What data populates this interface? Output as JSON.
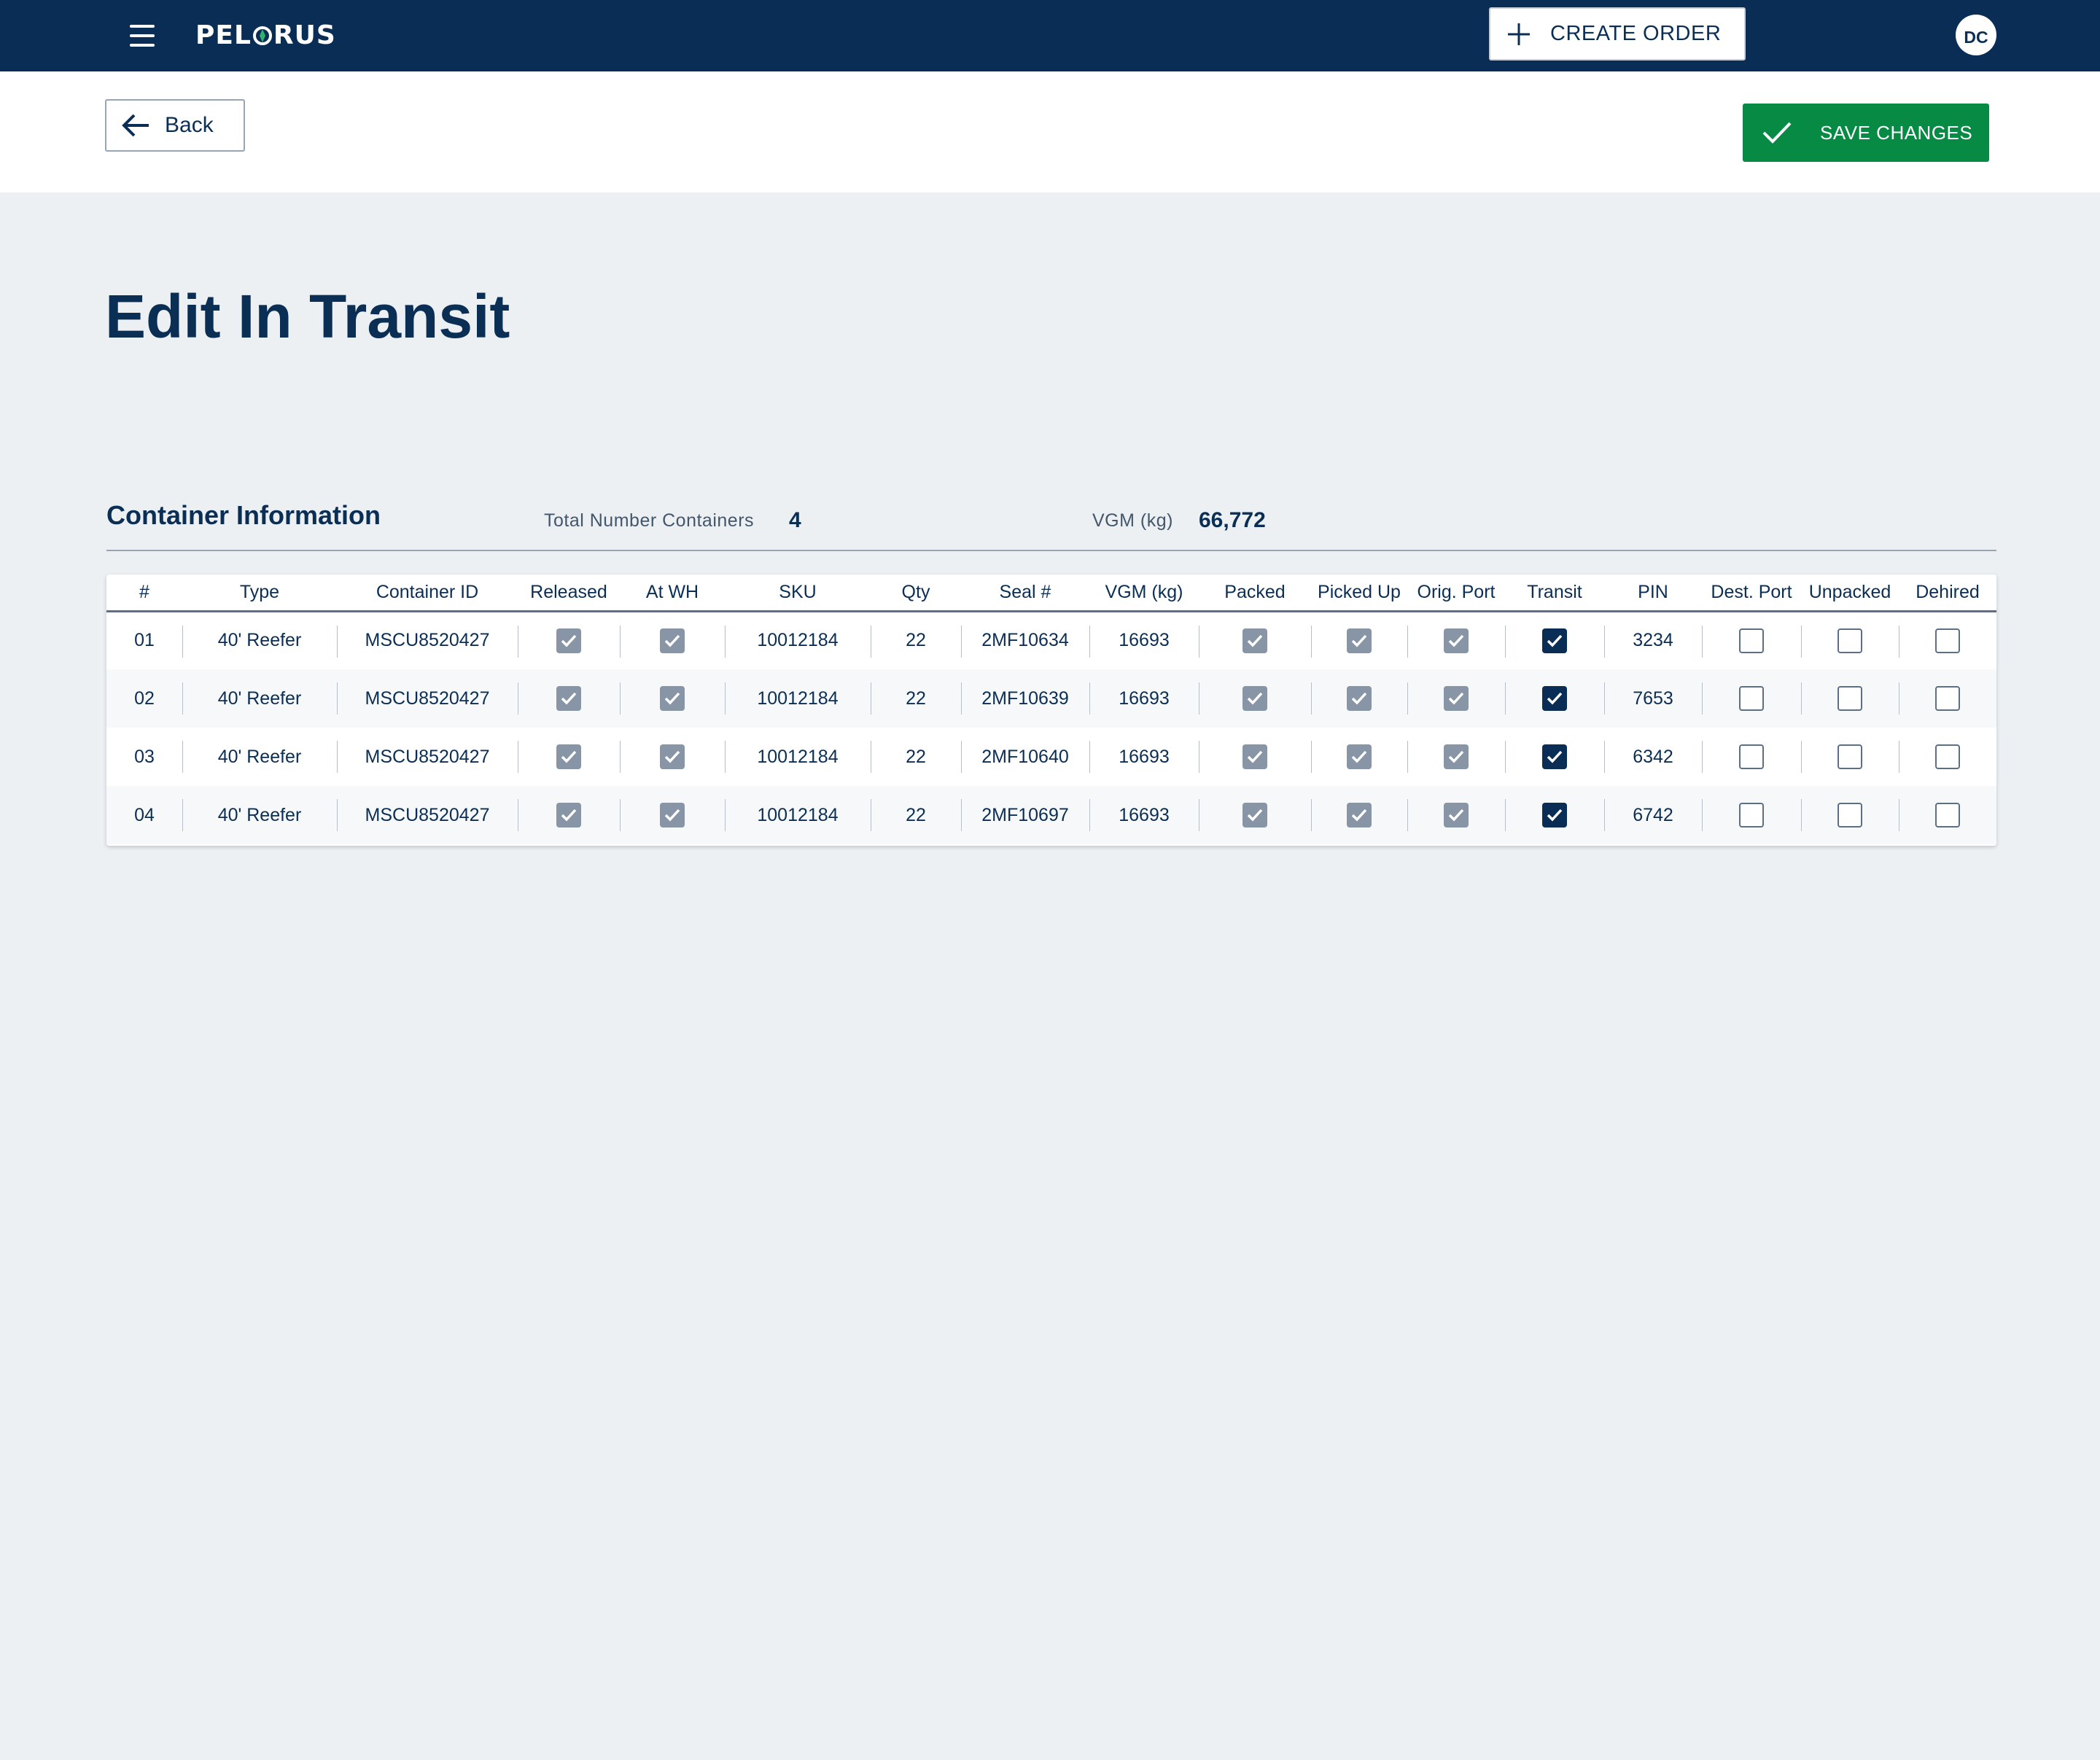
{
  "navbar": {
    "logo_prefix": "PEL",
    "logo_suffix": "RUS",
    "create_order_label": "CREATE ORDER",
    "avatar_initials": "DC",
    "brand_color": "#0a2d55"
  },
  "actionbar": {
    "back_label": "Back",
    "save_label": "SAVE CHANGES",
    "save_color": "#078a44"
  },
  "page": {
    "title": "Edit In Transit"
  },
  "section": {
    "title": "Container Information",
    "total_label": "Total Number Containers",
    "total_value": "4",
    "vgm_label": "VGM (kg)",
    "vgm_value": "66,772"
  },
  "table": {
    "columns": [
      "#",
      "Type",
      "Container ID",
      "Released",
      "At WH",
      "SKU",
      "Qty",
      "Seal #",
      "VGM (kg)",
      "Packed",
      "Picked Up",
      "Orig. Port",
      "Transit",
      "PIN",
      "Dest. Port",
      "Unpacked",
      "Dehired"
    ],
    "rows": [
      {
        "num": "01",
        "type": "40' Reefer",
        "container_id": "MSCU8520427",
        "released": true,
        "at_wh": true,
        "sku": "10012184",
        "qty": "22",
        "seal": "2MF10634",
        "vgm": "16693",
        "packed": true,
        "picked_up": true,
        "orig_port": true,
        "transit": true,
        "pin": "3234",
        "dest_port": false,
        "unpacked": false,
        "dehired": false
      },
      {
        "num": "02",
        "type": "40' Reefer",
        "container_id": "MSCU8520427",
        "released": true,
        "at_wh": true,
        "sku": "10012184",
        "qty": "22",
        "seal": "2MF10639",
        "vgm": "16693",
        "packed": true,
        "picked_up": true,
        "orig_port": true,
        "transit": true,
        "pin": "7653",
        "dest_port": false,
        "unpacked": false,
        "dehired": false
      },
      {
        "num": "03",
        "type": "40' Reefer",
        "container_id": "MSCU8520427",
        "released": true,
        "at_wh": true,
        "sku": "10012184",
        "qty": "22",
        "seal": "2MF10640",
        "vgm": "16693",
        "packed": true,
        "picked_up": true,
        "orig_port": true,
        "transit": true,
        "pin": "6342",
        "dest_port": false,
        "unpacked": false,
        "dehired": false
      },
      {
        "num": "04",
        "type": "40' Reefer",
        "container_id": "MSCU8520427",
        "released": true,
        "at_wh": true,
        "sku": "10012184",
        "qty": "22",
        "seal": "2MF10697",
        "vgm": "16693",
        "packed": true,
        "picked_up": true,
        "orig_port": true,
        "transit": true,
        "pin": "6742",
        "dest_port": false,
        "unpacked": false,
        "dehired": false
      }
    ]
  }
}
